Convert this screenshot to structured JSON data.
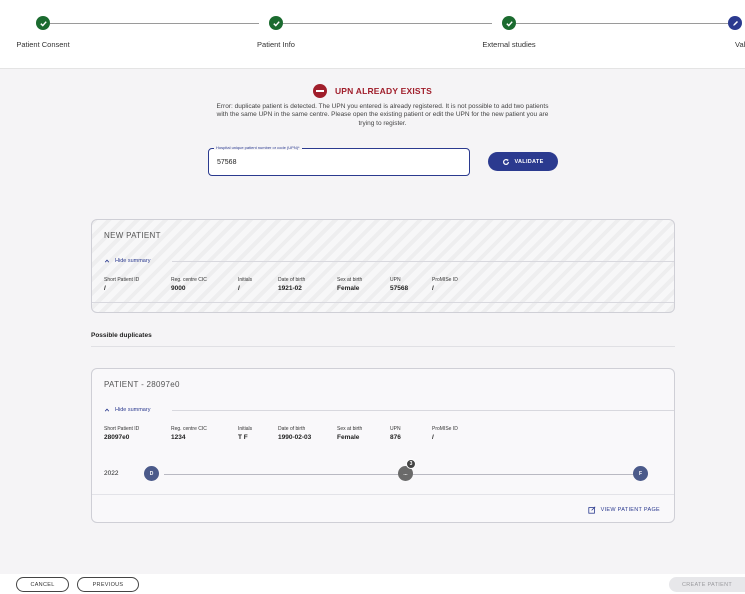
{
  "stepper": {
    "steps": [
      {
        "label": "Patient Consent",
        "state": "done"
      },
      {
        "label": "Patient Info",
        "state": "done"
      },
      {
        "label": "External studies",
        "state": "done"
      },
      {
        "label": "Validation",
        "state": "current"
      }
    ]
  },
  "error": {
    "title": "UPN ALREADY EXISTS",
    "message": "Error: duplicate patient is detected. The UPN you entered is already registered. It is not possible to add two patients with the same UPN in the same centre. Please open the existing patient or edit the UPN for the new patient you are trying to register."
  },
  "upn_input": {
    "label": "Hospital unique patient number or code (UPN)*",
    "value": "57568"
  },
  "validate_button": "VALIDATE",
  "new_patient": {
    "title": "NEW PATIENT",
    "toggle": "Hide summary",
    "fields": [
      {
        "label": "Short Patient ID",
        "value": "/"
      },
      {
        "label": "Reg. centre CIC",
        "value": "9000"
      },
      {
        "label": "Initials",
        "value": "/"
      },
      {
        "label": "Date of birth",
        "value": "1921-02"
      },
      {
        "label": "Sex at birth",
        "value": "Female"
      },
      {
        "label": "UPN",
        "value": "57568"
      },
      {
        "label": "ProMISe ID",
        "value": "/"
      }
    ]
  },
  "duplicates_heading": "Possible duplicates",
  "duplicate": {
    "title": "PATIENT - 28097e0",
    "toggle": "Hide summary",
    "fields": [
      {
        "label": "Short Patient ID",
        "value": "28097e0"
      },
      {
        "label": "Reg. centre CIC",
        "value": "1234"
      },
      {
        "label": "Initials",
        "value": "T F"
      },
      {
        "label": "Date of birth",
        "value": "1990-02-03"
      },
      {
        "label": "Sex at birth",
        "value": "Female"
      },
      {
        "label": "UPN",
        "value": "876"
      },
      {
        "label": "ProMISe ID",
        "value": "/"
      }
    ],
    "timeline": {
      "year": "2022",
      "start_node": "D",
      "middle_node": "...",
      "middle_badge": "3",
      "end_node": "F"
    },
    "view_page": "VIEW PATIENT PAGE"
  },
  "footer": {
    "cancel": "CANCEL",
    "previous": "PREVIOUS",
    "create": "CREATE PATIENT"
  },
  "colors": {
    "accent": "#2b3a8f",
    "success": "#1b6b2f",
    "error": "#a01e2b"
  }
}
